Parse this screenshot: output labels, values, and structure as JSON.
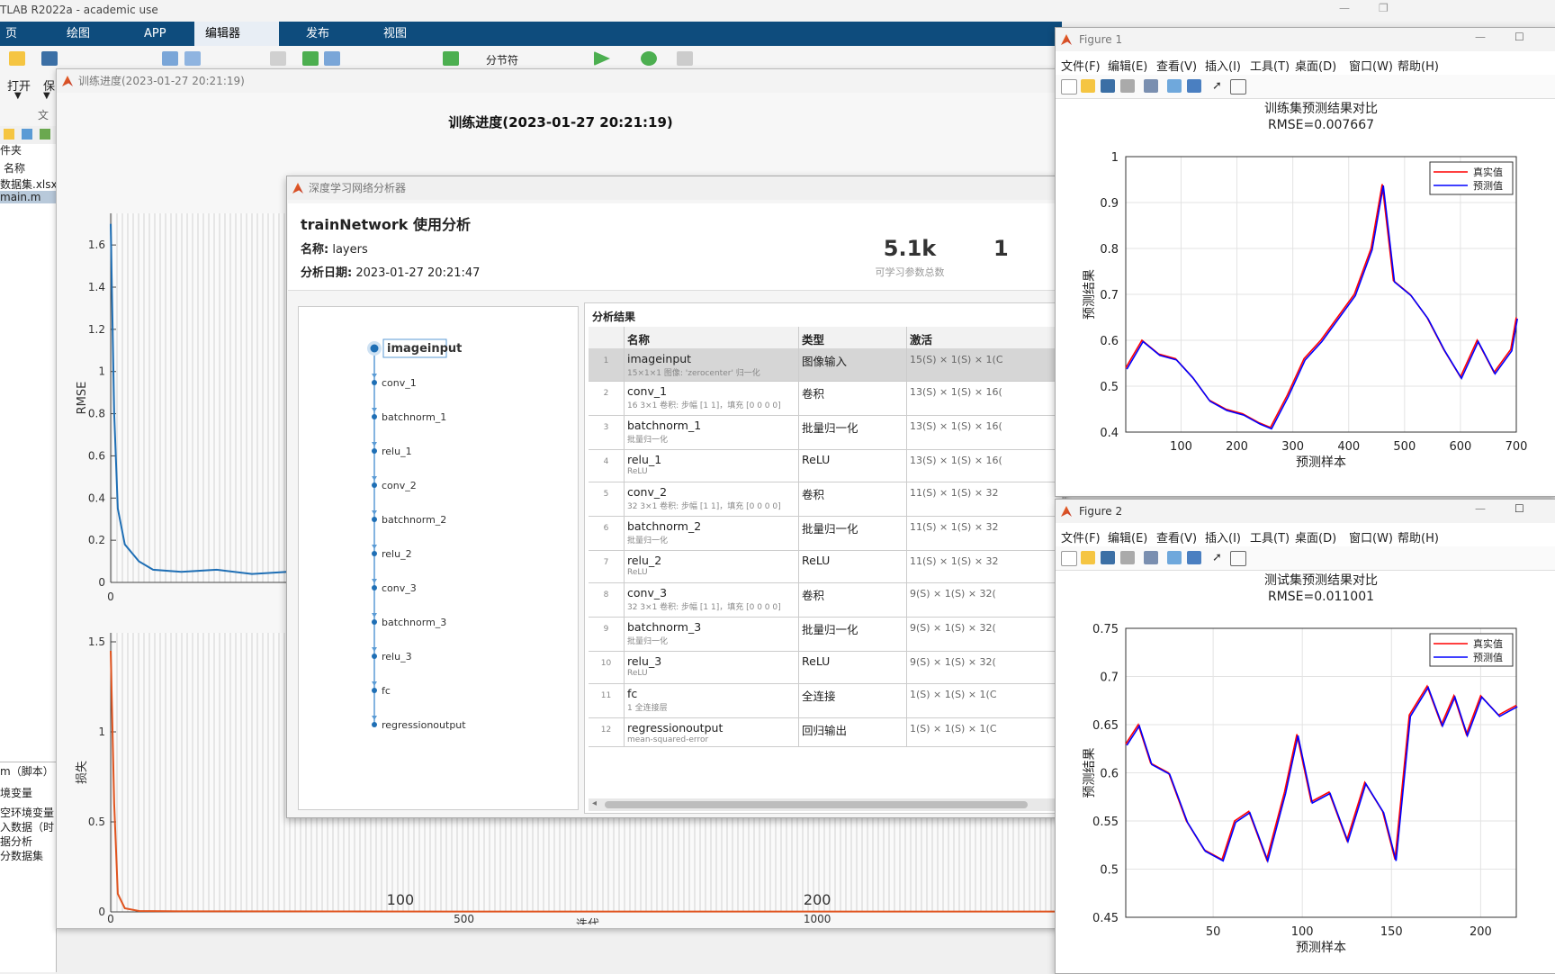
{
  "matlab": {
    "title": "TLAB R2022a - academic use",
    "tabs": [
      "页",
      "绘图",
      "APP",
      "编辑器",
      "发布",
      "视图"
    ],
    "ribbon": {
      "open": "打开",
      "save": "保",
      "section_break": "分节符",
      "file_group": "文"
    },
    "left_panel": {
      "folder_label": "件夹",
      "name_header": "名称",
      "files": [
        "数据集.xlsx",
        "main.m"
      ],
      "script_label": "m（脚本）",
      "workspace_items": [
        "境变量",
        "空环境变量",
        "入数据（时",
        "据分析",
        "分数据集"
      ]
    }
  },
  "training": {
    "window_title": "训练进度(2023-01-27 20:21:19)",
    "heading": "训练进度(2023-01-27 20:21:19)",
    "rmse_ylabel": "RMSE",
    "loss_ylabel": "损失",
    "xlabel": "迭代",
    "rmse_yticks": [
      "0",
      "0.2",
      "0.4",
      "0.6",
      "0.8",
      "1",
      "1.2",
      "1.4",
      "1.6"
    ],
    "loss_yticks": [
      "0",
      "0.5",
      "1",
      "1.5"
    ],
    "xticks": [
      "0",
      "500",
      "1000"
    ],
    "epoch_ticks": [
      "100",
      "200"
    ],
    "rmse_color": "#1f6fb5",
    "loss_color": "#e0541f"
  },
  "analyzer": {
    "window_title": "深度学习网络分析器",
    "heading": "trainNetwork 使用分析",
    "name_label": "名称:",
    "name_value": "layers",
    "date_label": "分析日期:",
    "date_value": "2023-01-27 20:21:47",
    "param_count": "5.1k",
    "param_label": "可学习参数总数",
    "extra_metric": "1",
    "graph_layers": [
      "imageinput",
      "conv_1",
      "batchnorm_1",
      "relu_1",
      "conv_2",
      "batchnorm_2",
      "relu_2",
      "conv_3",
      "batchnorm_3",
      "relu_3",
      "fc",
      "regressionoutput"
    ],
    "results_title": "分析结果",
    "columns": [
      "名称",
      "类型",
      "激活"
    ],
    "rows": [
      {
        "idx": "1",
        "name": "imageinput",
        "desc": "15×1×1 图像: 'zerocenter' 归一化",
        "type": "图像输入",
        "act": "15(S)  ×  1(S)  ×  1(C"
      },
      {
        "idx": "2",
        "name": "conv_1",
        "desc": "16 3×1 卷积: 步幅 [1 1]，填充 [0 0 0 0]",
        "type": "卷积",
        "act": "13(S)  ×  1(S)  ×  16("
      },
      {
        "idx": "3",
        "name": "batchnorm_1",
        "desc": "批量归一化",
        "type": "批量归一化",
        "act": "13(S)  ×  1(S)  ×  16("
      },
      {
        "idx": "4",
        "name": "relu_1",
        "desc": "ReLU",
        "type": "ReLU",
        "act": "13(S)  ×  1(S)  ×  16("
      },
      {
        "idx": "5",
        "name": "conv_2",
        "desc": "32 3×1 卷积: 步幅 [1 1]，填充 [0 0 0 0]",
        "type": "卷积",
        "act": "11(S)  ×  1(S)  ×  32"
      },
      {
        "idx": "6",
        "name": "batchnorm_2",
        "desc": "批量归一化",
        "type": "批量归一化",
        "act": "11(S)  ×  1(S)  ×  32"
      },
      {
        "idx": "7",
        "name": "relu_2",
        "desc": "ReLU",
        "type": "ReLU",
        "act": "11(S)  ×  1(S)  ×  32"
      },
      {
        "idx": "8",
        "name": "conv_3",
        "desc": "32 3×1 卷积: 步幅 [1 1]，填充 [0 0 0 0]",
        "type": "卷积",
        "act": "9(S)  ×  1(S)  ×  32("
      },
      {
        "idx": "9",
        "name": "batchnorm_3",
        "desc": "批量归一化",
        "type": "批量归一化",
        "act": "9(S)  ×  1(S)  ×  32("
      },
      {
        "idx": "10",
        "name": "relu_3",
        "desc": "ReLU",
        "type": "ReLU",
        "act": "9(S)  ×  1(S)  ×  32("
      },
      {
        "idx": "11",
        "name": "fc",
        "desc": "1 全连接层",
        "type": "全连接",
        "act": "1(S)  ×  1(S)  ×  1(C"
      },
      {
        "idx": "12",
        "name": "regressionoutput",
        "desc": "mean-squared-error",
        "type": "回归输出",
        "act": "1(S)  ×  1(S)  ×  1(C"
      }
    ]
  },
  "figure1": {
    "window_title": "Figure 1",
    "menu": [
      "文件(F)",
      "编辑(E)",
      "查看(V)",
      "插入(I)",
      "工具(T)",
      "桌面(D)",
      "窗口(W)",
      "帮助(H)"
    ],
    "title": "训练集预测结果对比",
    "subtitle": "RMSE=0.007667",
    "ylabel": "预测结果",
    "xlabel": "预测样本",
    "yticks": [
      "0.4",
      "0.5",
      "0.6",
      "0.7",
      "0.8",
      "0.9",
      "1"
    ],
    "xticks": [
      "100",
      "200",
      "300",
      "400",
      "500",
      "600",
      "700"
    ],
    "legend": [
      "真实值",
      "预测值"
    ]
  },
  "figure2": {
    "window_title": "Figure 2",
    "menu": [
      "文件(F)",
      "编辑(E)",
      "查看(V)",
      "插入(I)",
      "工具(T)",
      "桌面(D)",
      "窗口(W)",
      "帮助(H)"
    ],
    "title": "测试集预测结果对比",
    "subtitle": "RMSE=0.011001",
    "ylabel": "预测结果",
    "xlabel": "预测样本",
    "yticks": [
      "0.45",
      "0.5",
      "0.55",
      "0.6",
      "0.65",
      "0.7",
      "0.75"
    ],
    "xticks": [
      "50",
      "100",
      "150",
      "200"
    ],
    "legend": [
      "真实值",
      "预测值"
    ]
  },
  "chart_data": [
    {
      "type": "line",
      "title": "训练集预测结果对比",
      "subtitle": "RMSE=0.007667",
      "xlabel": "预测样本",
      "ylabel": "预测结果",
      "xlim": [
        1,
        700
      ],
      "ylim": [
        0.4,
        1
      ],
      "grid": true,
      "legend_position": "top-right",
      "series": [
        {
          "name": "真实值",
          "color": "#ff0000"
        },
        {
          "name": "预测值",
          "color": "#0000ff"
        }
      ],
      "x": [
        1,
        30,
        60,
        90,
        120,
        150,
        180,
        210,
        240,
        260,
        290,
        320,
        350,
        380,
        410,
        440,
        460,
        480,
        510,
        540,
        570,
        600,
        630,
        660,
        690,
        700
      ],
      "values": [
        0.54,
        0.6,
        0.57,
        0.56,
        0.52,
        0.47,
        0.45,
        0.44,
        0.42,
        0.41,
        0.48,
        0.56,
        0.6,
        0.65,
        0.7,
        0.8,
        0.94,
        0.73,
        0.7,
        0.65,
        0.58,
        0.52,
        0.6,
        0.53,
        0.58,
        0.65
      ]
    },
    {
      "type": "line",
      "title": "测试集预测结果对比",
      "subtitle": "RMSE=0.011001",
      "xlabel": "预测样本",
      "ylabel": "预测结果",
      "xlim": [
        1,
        220
      ],
      "ylim": [
        0.45,
        0.75
      ],
      "grid": true,
      "legend_position": "top-right",
      "series": [
        {
          "name": "真实值",
          "color": "#ff0000"
        },
        {
          "name": "预测值",
          "color": "#0000ff"
        }
      ],
      "x": [
        1,
        8,
        15,
        25,
        35,
        45,
        55,
        62,
        70,
        80,
        90,
        97,
        105,
        115,
        125,
        135,
        145,
        152,
        160,
        170,
        178,
        185,
        192,
        200,
        210,
        220
      ],
      "values": [
        0.63,
        0.65,
        0.61,
        0.6,
        0.55,
        0.52,
        0.51,
        0.55,
        0.56,
        0.51,
        0.58,
        0.64,
        0.57,
        0.58,
        0.53,
        0.59,
        0.56,
        0.51,
        0.66,
        0.69,
        0.65,
        0.68,
        0.64,
        0.68,
        0.66,
        0.67
      ]
    },
    {
      "type": "line",
      "title": "训练进度(2023-01-27 20:21:19)",
      "xlabel": "迭代",
      "ylabel": "RMSE",
      "xlim": [
        0,
        1350
      ],
      "ylim": [
        0,
        1.75
      ],
      "series": [
        {
          "name": "",
          "color": "#1f6fb5"
        }
      ],
      "x": [
        0,
        5,
        10,
        20,
        40,
        60,
        100,
        150,
        200,
        250,
        300,
        350
      ],
      "values": [
        1.7,
        0.8,
        0.35,
        0.18,
        0.1,
        0.06,
        0.05,
        0.06,
        0.04,
        0.05,
        0.04,
        0.05
      ]
    },
    {
      "type": "line",
      "title": "",
      "xlabel": "迭代",
      "ylabel": "损失",
      "xlim": [
        0,
        1350
      ],
      "ylim": [
        0,
        1.55
      ],
      "series": [
        {
          "name": "",
          "color": "#e0541f"
        }
      ],
      "x": [
        0,
        5,
        10,
        20,
        40,
        100,
        500,
        1000,
        1350
      ],
      "values": [
        1.45,
        0.6,
        0.1,
        0.02,
        0.005,
        0.003,
        0.002,
        0.002,
        0.002
      ]
    }
  ]
}
